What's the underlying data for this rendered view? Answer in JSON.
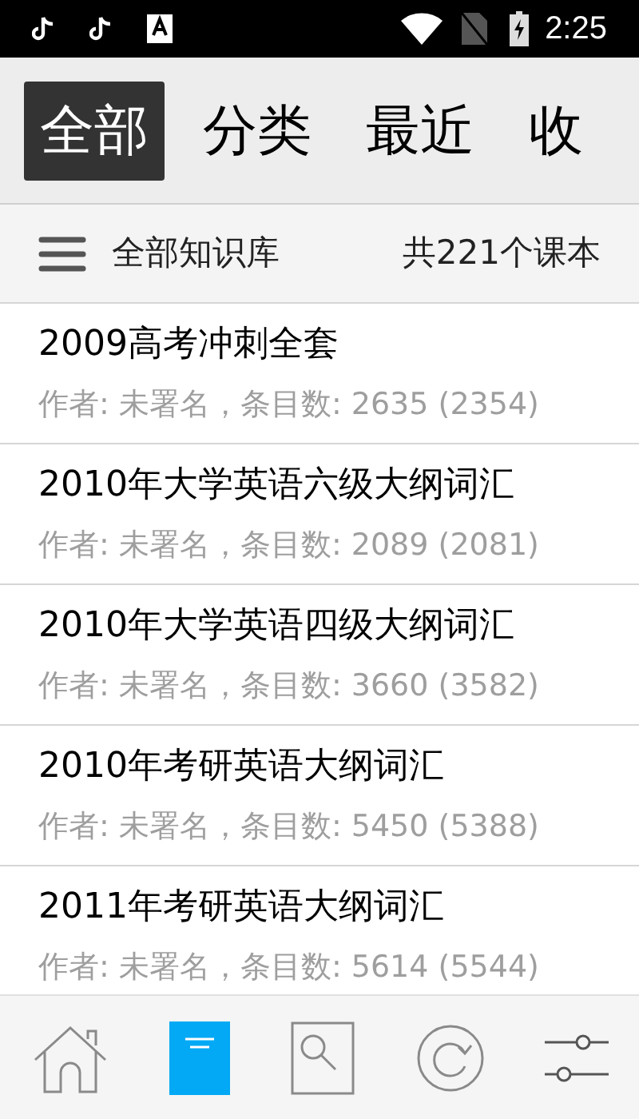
{
  "status_bar": {
    "time": "2:25"
  },
  "tabs": [
    {
      "label": "全部",
      "selected": true
    },
    {
      "label": "分类",
      "selected": false
    },
    {
      "label": "最近",
      "selected": false
    },
    {
      "label": "收",
      "selected": false
    }
  ],
  "header": {
    "title": "全部知识库",
    "count": "共221个课本"
  },
  "items": [
    {
      "title": "2009高考冲刺全套",
      "meta": "作者: 未署名，条目数: 2635 (2354)"
    },
    {
      "title": "2010年大学英语六级大纲词汇",
      "meta": "作者: 未署名，条目数: 2089 (2081)"
    },
    {
      "title": "2010年大学英语四级大纲词汇",
      "meta": "作者: 未署名，条目数: 3660 (3582)"
    },
    {
      "title": "2010年考研英语大纲词汇",
      "meta": "作者: 未署名，条目数: 5450 (5388)"
    },
    {
      "title": "2011年考研英语大纲词汇",
      "meta": "作者: 未署名，条目数: 5614 (5544)"
    }
  ],
  "bottom_nav": [
    {
      "kind": "home",
      "selected": false
    },
    {
      "kind": "books",
      "selected": true
    },
    {
      "kind": "search",
      "selected": false
    },
    {
      "kind": "review",
      "selected": false
    },
    {
      "kind": "settings",
      "selected": false
    }
  ]
}
